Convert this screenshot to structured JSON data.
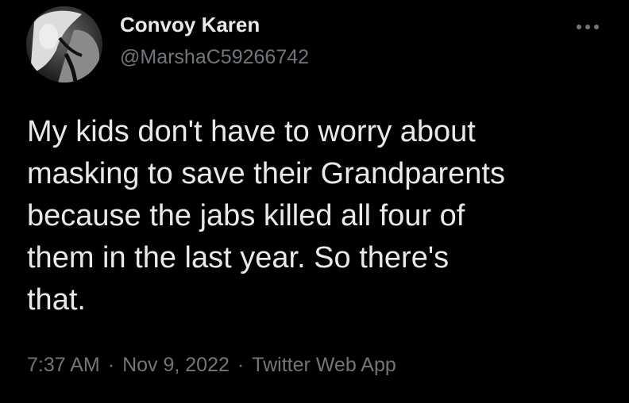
{
  "tweet": {
    "author": {
      "display_name": "Convoy Karen",
      "handle": "@MarshaC59266742",
      "avatar_icon": "profile-photo-avatar"
    },
    "more_icon": "more-options-icon",
    "text": "My kids don't have to worry about\nmasking to save their Grandparents\nbecause the jabs killed all four of\nthem in the last year. So there's\nthat.",
    "time": "7:37 AM",
    "separator": "·",
    "date": "Nov 9, 2022",
    "source": "Twitter Web App"
  },
  "colors": {
    "background": "#000000",
    "primary_text": "#e7e9ea",
    "secondary_text": "#71767b"
  }
}
